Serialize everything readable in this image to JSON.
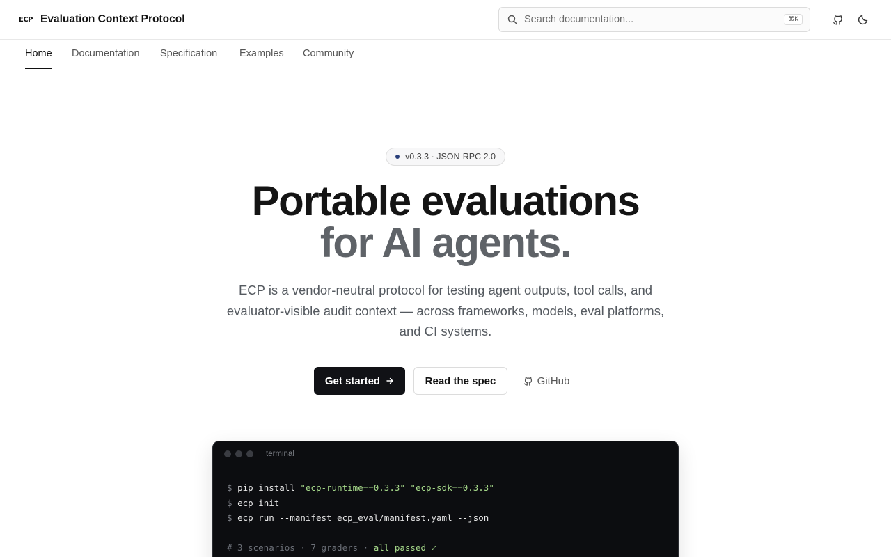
{
  "header": {
    "logo": "ECP",
    "title": "Evaluation Context Protocol",
    "search_placeholder": "Search documentation...",
    "search_shortcut": "⌘K",
    "github_icon": "github-icon",
    "theme_icon": "moon-icon"
  },
  "nav": {
    "tabs": [
      {
        "label": "Home",
        "active": true
      },
      {
        "label": "Documentation",
        "active": false
      },
      {
        "label": "Specification",
        "active": false
      },
      {
        "label": "Examples",
        "active": false
      },
      {
        "label": "Community",
        "active": false
      }
    ]
  },
  "hero": {
    "badge": "v0.3.3 · JSON-RPC 2.0",
    "headline_line1": "Portable evaluations",
    "headline_line2": "for AI agents.",
    "description": "ECP is a vendor-neutral protocol for testing agent outputs, tool calls, and evaluator-visible audit context — across frameworks, models, eval platforms, and CI systems.",
    "buttons": {
      "primary": "Get started",
      "secondary": "Read the spec",
      "ghost": "GitHub"
    }
  },
  "terminal": {
    "title": "terminal",
    "lines": [
      {
        "prompt": "$",
        "cmd": "pip install",
        "args": [
          " \"ecp-runtime==0.3.3\"",
          " \"ecp-sdk==0.3.3\""
        ]
      },
      {
        "prompt": "$",
        "cmd": "ecp init",
        "args": []
      },
      {
        "prompt": "$",
        "cmd": "ecp run --manifest ecp_eval/manifest.yaml --json",
        "args": []
      }
    ],
    "summary_comment": "# 3 scenarios · 7 graders · ",
    "summary_status": "all passed ✓"
  },
  "colors": {
    "primary_button": "#111216",
    "headline_secondary": "#5f6368",
    "terminal_bg": "#0c0d10",
    "terminal_string": "#a6d98a",
    "badge_dot": "#2a3f7a"
  }
}
